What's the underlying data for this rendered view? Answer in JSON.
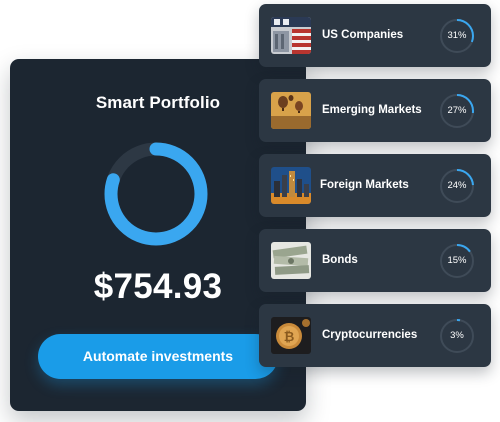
{
  "portfolio": {
    "title": "Smart Portfolio",
    "amount": "$754.93",
    "allocation_fraction": 0.8,
    "cta_label": "Automate investments"
  },
  "colors": {
    "card_bg": "#1c2631",
    "row_bg": "#2c3743",
    "accent": "#3aa7f0",
    "button": "#1a9ce8",
    "ring_track": "#3f4b58"
  },
  "assets": [
    {
      "label": "US Companies",
      "percent_text": "31%",
      "fraction": 0.31,
      "icon": "stock-ticker-image-icon"
    },
    {
      "label": "Emerging Markets",
      "percent_text": "27%",
      "fraction": 0.27,
      "icon": "hot-air-balloons-image-icon"
    },
    {
      "label": "Foreign Markets",
      "percent_text": "24%",
      "fraction": 0.24,
      "icon": "city-skyline-image-icon"
    },
    {
      "label": "Bonds",
      "percent_text": "15%",
      "fraction": 0.15,
      "icon": "banknotes-image-icon"
    },
    {
      "label": "Cryptocurrencies",
      "percent_text": "3%",
      "fraction": 0.03,
      "icon": "bitcoin-coin-image-icon"
    }
  ]
}
